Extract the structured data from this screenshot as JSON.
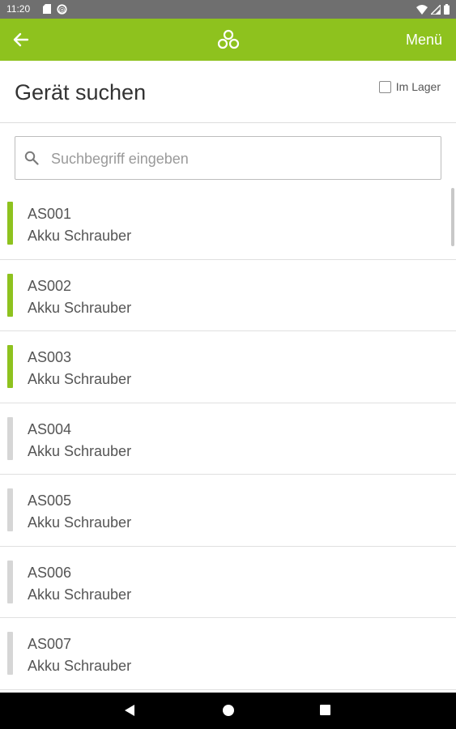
{
  "status_bar": {
    "time": "11:20",
    "icons": [
      "sd-card-icon",
      "sync-icon",
      "wifi-icon",
      "signal-icon",
      "battery-icon"
    ]
  },
  "app_bar": {
    "menu_label": "Menü",
    "color": "#8ec21e"
  },
  "header": {
    "title": "Gerät suchen",
    "in_stock_label": "Im Lager",
    "in_stock_checked": false
  },
  "search": {
    "placeholder": "Suchbegriff eingeben"
  },
  "devices": [
    {
      "code": "AS001",
      "name": "Akku Schrauber",
      "status_color": "#8ec21e"
    },
    {
      "code": "AS002",
      "name": "Akku Schrauber",
      "status_color": "#8ec21e"
    },
    {
      "code": "AS003",
      "name": "Akku Schrauber",
      "status_color": "#8ec21e"
    },
    {
      "code": "AS004",
      "name": "Akku Schrauber",
      "status_color": "#d6d6d6"
    },
    {
      "code": "AS005",
      "name": "Akku Schrauber",
      "status_color": "#d6d6d6"
    },
    {
      "code": "AS006",
      "name": "Akku Schrauber",
      "status_color": "#d6d6d6"
    },
    {
      "code": "AS007",
      "name": "Akku Schrauber",
      "status_color": "#d6d6d6"
    }
  ],
  "nav_bar": {
    "buttons": [
      "back-nav",
      "home-nav",
      "recents-nav"
    ]
  }
}
